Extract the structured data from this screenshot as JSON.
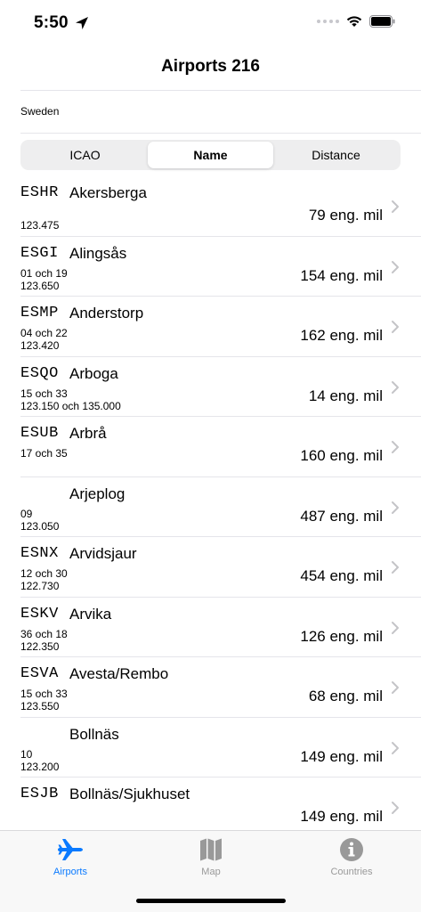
{
  "status": {
    "time": "5:50"
  },
  "nav": {
    "title": "Airports 216"
  },
  "country": "Sweden",
  "segments": [
    {
      "label": "ICAO"
    },
    {
      "label": "Name"
    },
    {
      "label": "Distance"
    }
  ],
  "active_segment": "Name",
  "airports": [
    {
      "code": "ESHR",
      "name": "Akersberga",
      "runway": "",
      "freq": "123.475",
      "dist": "79 eng. mil"
    },
    {
      "code": "ESGI",
      "name": "Alingsås",
      "runway": "01 och 19",
      "freq": "123.650",
      "dist": "154 eng. mil"
    },
    {
      "code": "ESMP",
      "name": "Anderstorp",
      "runway": "04 och 22",
      "freq": "123.420",
      "dist": "162 eng. mil"
    },
    {
      "code": "ESQO",
      "name": "Arboga",
      "runway": "15 och 33",
      "freq": "123.150 och 135.000",
      "dist": "14 eng. mil"
    },
    {
      "code": "ESUB",
      "name": "Arbrå",
      "runway": "17 och 35",
      "freq": "",
      "dist": "160 eng. mil"
    },
    {
      "code": "",
      "name": "Arjeplog",
      "runway": "09",
      "freq": "123.050",
      "dist": "487 eng. mil"
    },
    {
      "code": "ESNX",
      "name": "Arvidsjaur",
      "runway": "12 och 30",
      "freq": "122.730",
      "dist": "454 eng. mil"
    },
    {
      "code": "ESKV",
      "name": "Arvika",
      "runway": "36 och 18",
      "freq": "122.350",
      "dist": "126 eng. mil"
    },
    {
      "code": "ESVA",
      "name": "Avesta/Rembo",
      "runway": "15 och 33",
      "freq": "123.550",
      "dist": "68 eng. mil"
    },
    {
      "code": "",
      "name": "Bollnäs",
      "runway": "10",
      "freq": "123.200",
      "dist": "149 eng. mil"
    },
    {
      "code": "ESJB",
      "name": "Bollnäs/Sjukhuset",
      "runway": "",
      "freq": "",
      "dist": "149 eng. mil"
    }
  ],
  "tabs": [
    {
      "label": "Airports",
      "icon": "airplane-icon",
      "active": true
    },
    {
      "label": "Map",
      "icon": "map-icon",
      "active": false
    },
    {
      "label": "Countries",
      "icon": "info-icon",
      "active": false
    }
  ],
  "colors": {
    "accent": "#0a7aff",
    "inactive": "#999999",
    "separator": "#e5e5ea"
  }
}
